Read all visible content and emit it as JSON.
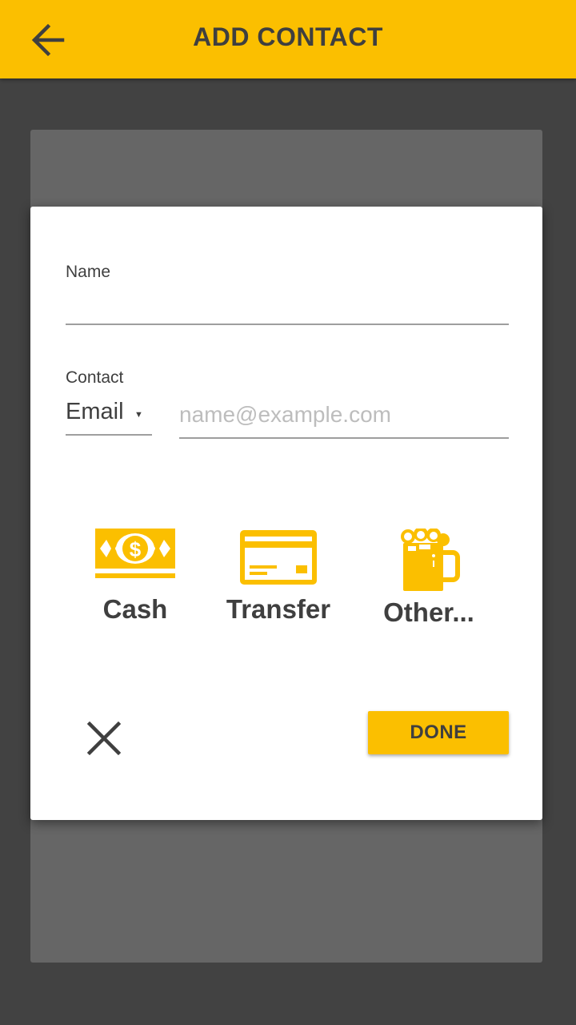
{
  "app_bar": {
    "title": "ADD CONTACT",
    "back_icon": "arrow-back-icon",
    "background_color": "#FBBF00"
  },
  "form": {
    "name": {
      "label": "Name",
      "value": "",
      "placeholder": ""
    },
    "contact": {
      "label": "Contact",
      "type_selected": "Email",
      "value": "",
      "placeholder": "name@example.com"
    }
  },
  "payment_options": [
    {
      "label": "Cash",
      "icon": "cash-icon"
    },
    {
      "label": "Transfer",
      "icon": "credit-card-icon"
    },
    {
      "label": "Other...",
      "icon": "beer-mug-icon"
    }
  ],
  "actions": {
    "close_icon": "close-icon",
    "done_label": "DONE"
  },
  "colors": {
    "accent": "#FBBF00",
    "text": "#3f3f3f",
    "screen_bg": "#424242",
    "card_bg": "#666666"
  }
}
